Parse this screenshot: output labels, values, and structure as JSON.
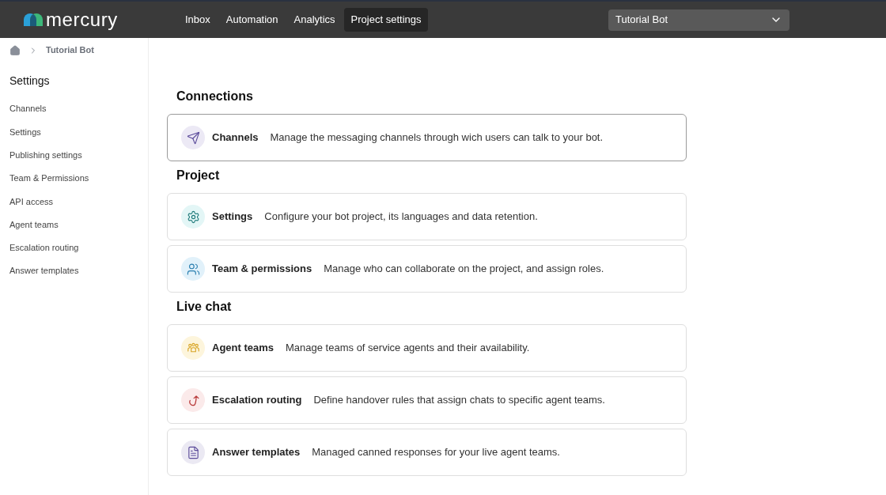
{
  "header": {
    "logo_text": "mercury",
    "nav": [
      {
        "label": "Inbox",
        "selected": false
      },
      {
        "label": "Automation",
        "selected": false
      },
      {
        "label": "Analytics",
        "selected": false
      },
      {
        "label": "Project settings",
        "selected": true
      }
    ],
    "project_select": {
      "value": "Tutorial Bot"
    }
  },
  "breadcrumb": {
    "items": [
      "Tutorial Bot"
    ]
  },
  "sidebar": {
    "title": "Settings",
    "items": [
      "Channels",
      "Settings",
      "Publishing settings",
      "Team & Permissions",
      "API access",
      "Agent teams",
      "Escalation routing",
      "Answer templates"
    ]
  },
  "sections": [
    {
      "title": "Connections",
      "cards": [
        {
          "kind": "send",
          "color": "#ece9f5",
          "title": "Channels",
          "description": "Manage the messaging channels through wich users can talk to your bot.",
          "selected": true
        }
      ]
    },
    {
      "title": "Project",
      "cards": [
        {
          "kind": "gear",
          "color": "#e3f6f6",
          "title": "Settings",
          "description": "Configure your bot project, its languages and data retention.",
          "selected": false
        },
        {
          "kind": "users",
          "color": "#e1f1fa",
          "title": "Team & permissions",
          "description": "Manage who can collaborate on the project, and assign roles.",
          "selected": false
        }
      ]
    },
    {
      "title": "Live chat",
      "cards": [
        {
          "kind": "group",
          "color": "#fdf5dc",
          "title": "Agent teams",
          "description": "Manage teams of service agents and their availability.",
          "selected": false
        },
        {
          "kind": "route",
          "color": "#fbeaea",
          "title": "Escalation routing",
          "description": "Define handover rules that assign chats to specific agent teams.",
          "selected": false
        },
        {
          "kind": "file",
          "color": "#ebe9f3",
          "title": "Answer templates",
          "description": "Managed canned responses for your live agent teams.",
          "selected": false
        }
      ]
    }
  ]
}
